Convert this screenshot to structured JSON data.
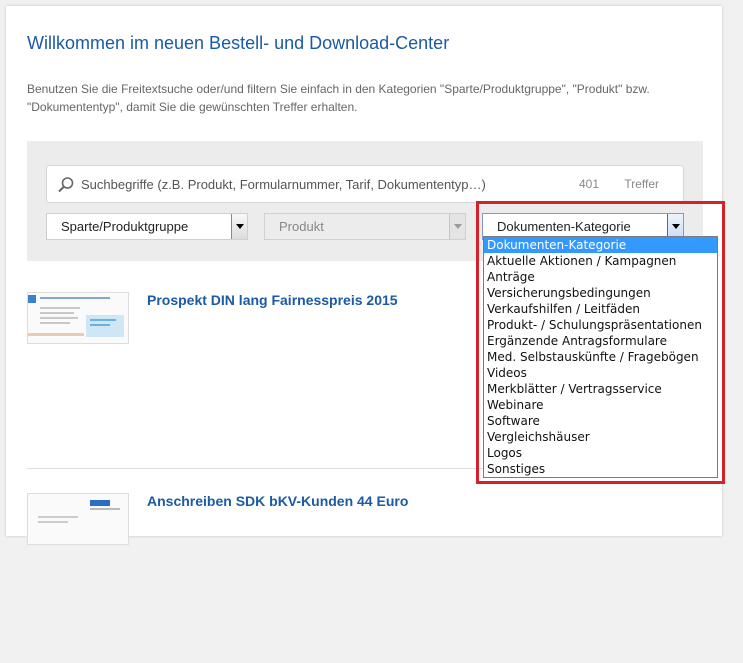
{
  "page": {
    "title": "Willkommen im neuen Bestell- und Download-Center",
    "intro": "Benutzen Sie die Freitextsuche oder/und filtern Sie einfach in den Kategorien \"Sparte/Produktgruppe\", \"Produkt\" bzw. \"Dokumententyp\", damit Sie die gewünschten Treffer erhalten."
  },
  "search": {
    "placeholder": "Suchbegriffe (z.B. Produkt, Formularnummer, Tarif, Dokumententyp…)",
    "value": "",
    "count": "401",
    "count_label": "Treffer"
  },
  "filters": {
    "sparte": {
      "selected": "Sparte/Produktgruppe"
    },
    "produkt": {
      "selected": "Produkt"
    },
    "kategorie": {
      "selected": "Dokumenten-Kategorie",
      "options": [
        "Dokumenten-Kategorie",
        "Aktuelle Aktionen / Kampagnen",
        "Anträge",
        "Versicherungsbedingungen",
        "Verkaufshilfen / Leitfäden",
        "Produkt- / Schulungspräsentationen",
        "Ergänzende Antragsformulare",
        "Med. Selbstauskünfte / Fragebögen",
        "Videos",
        "Merkblätter / Vertragsservice",
        "Webinare",
        "Software",
        "Vergleichshäuser",
        "Logos",
        "Sonstiges"
      ]
    }
  },
  "results": [
    {
      "title": "Prospekt DIN lang Fairnesspreis 2015"
    },
    {
      "title": "Anschreiben SDK bKV-Kunden 44 Euro"
    }
  ],
  "colors": {
    "link_blue": "#1b5aa6",
    "highlight_red": "#d8202a",
    "selection_blue": "#3399ff"
  },
  "icons": {
    "search": "magnifier-icon",
    "dropdown": "triangle-down-icon"
  }
}
